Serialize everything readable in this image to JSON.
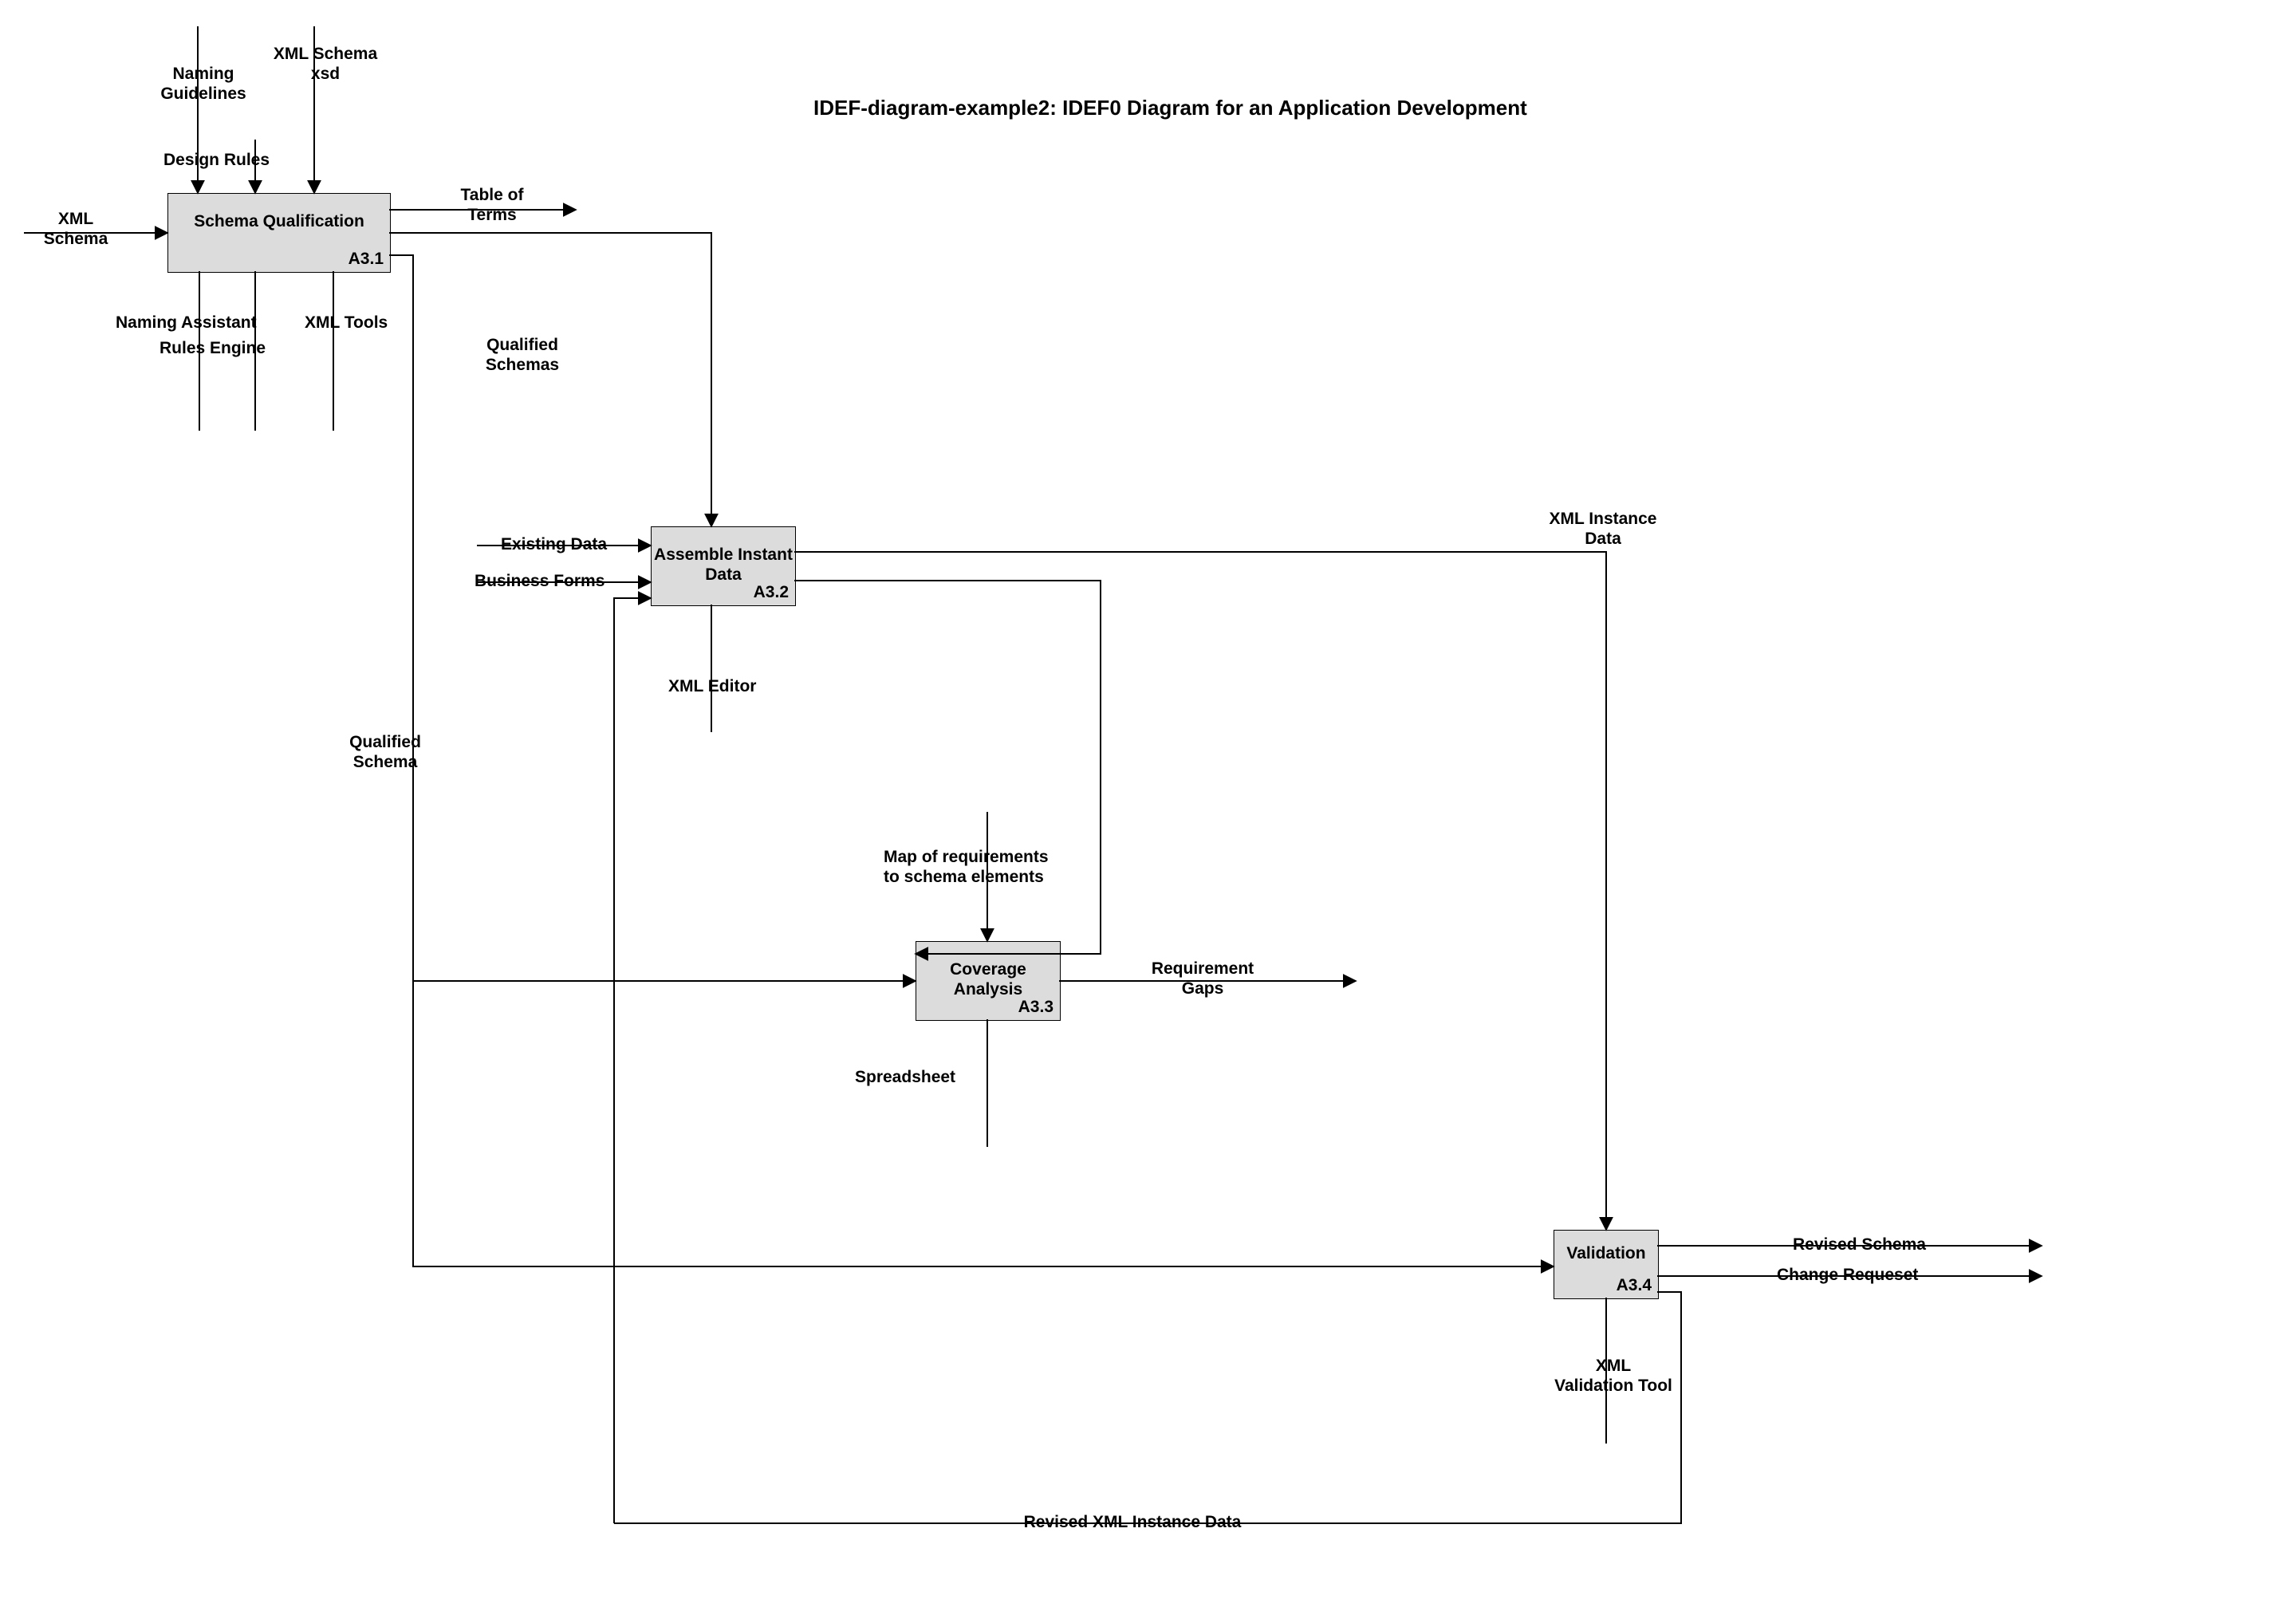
{
  "title": "IDEF-diagram-example2: IDEF0 Diagram for an Application Development",
  "boxes": {
    "b1": {
      "name": "Schema Qualification",
      "id": "A3.1"
    },
    "b2": {
      "name": "Assemble Instant Data",
      "id": "A3.2"
    },
    "b3": {
      "name": "Coverage Analysis",
      "id": "A3.3"
    },
    "b4": {
      "name": "Validation",
      "id": "A3.4"
    }
  },
  "labels": {
    "naming_guidelines": "Naming\nGuidelines",
    "xml_schema_xsd": "XML Schema\nxsd",
    "design_rules": "Design Rules",
    "xml_schema": "XML\nSchema",
    "table_of_terms": "Table of\nTerms",
    "naming_assistant": "Naming Assistant",
    "rules_engine": "Rules Engine",
    "xml_tools": "XML Tools",
    "qualified_schemas": "Qualified\nSchemas",
    "existing_data": "Existing Data",
    "business_forms": "Business Forms",
    "xml_editor": "XML Editor",
    "xml_instance_data": "XML Instance\nData",
    "qualified_schema": "Qualified\nSchema",
    "map_requirements": "Map of requirements\nto schema elements",
    "requirement_gaps": "Requirement\nGaps",
    "spreadsheet": "Spreadsheet",
    "revised_schema": "Revised Schema",
    "change_request": "Change Requeset",
    "xml_validation_tool": "XML\nValidation Tool",
    "revised_xml_instance_data": "Revised XML Instance Data"
  }
}
